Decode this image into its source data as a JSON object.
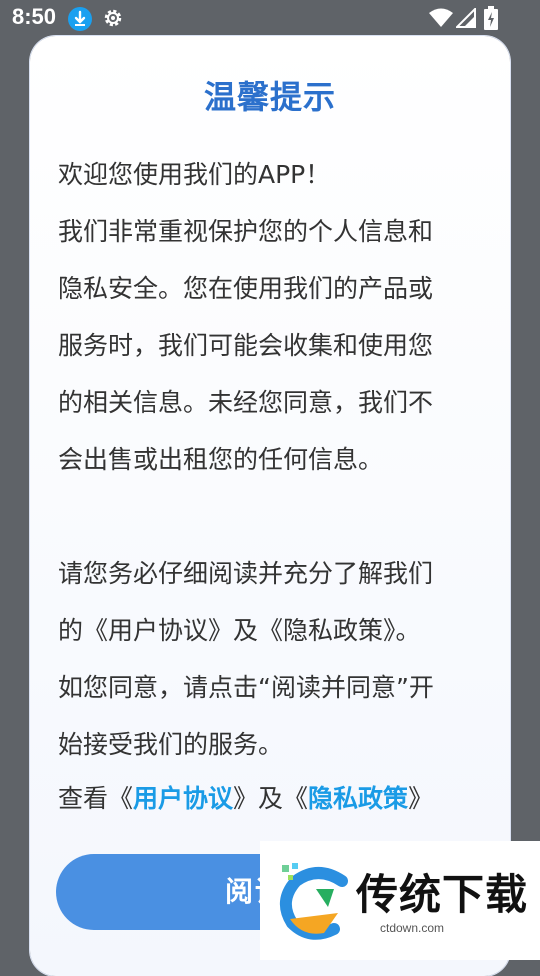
{
  "status_bar": {
    "time": "8:50",
    "icons": [
      "download-icon",
      "gear-icon",
      "wifi-icon",
      "signal-icon",
      "battery-icon"
    ]
  },
  "dialog": {
    "title": "温馨提示",
    "paragraph1": [
      "欢迎您使用我们的APP！",
      "我们非常重视保护您的个人信息和",
      "隐私安全。您在使用我们的产品或",
      "服务时，我们可能会收集和使用您",
      "的相关信息。未经您同意，我们不",
      "会出售或出租您的任何信息。"
    ],
    "paragraph2": [
      "请您务必仔细阅读并充分了解我们",
      "的《用户协议》及《隐私政策》。",
      "如您同意，请点击“阅读并同意”开",
      "始接受我们的服务。"
    ],
    "links_prefix": "查看《",
    "user_agreement_link": "用户协议",
    "links_middle": "》及《",
    "privacy_policy_link": "隐私政策",
    "links_suffix": "》",
    "agree_button": "阅读并"
  },
  "watermark": {
    "brand": "传统下载",
    "url": "ctdown.com"
  },
  "colors": {
    "title": "#2b70cc",
    "link": "#1a9be6",
    "button": "#4a90e2",
    "background": "#5f6368"
  }
}
